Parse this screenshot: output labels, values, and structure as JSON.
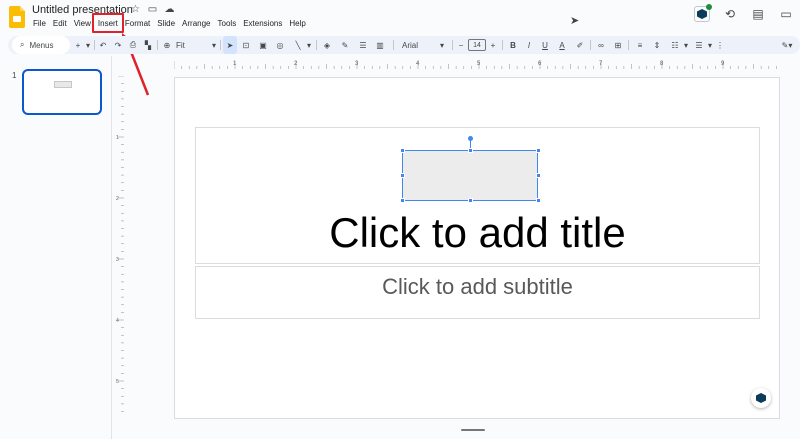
{
  "app": {
    "document_title": "Untitled presentation"
  },
  "menu": {
    "items": [
      "File",
      "Edit",
      "View",
      "Insert",
      "Format",
      "Slide",
      "Arrange",
      "Tools",
      "Extensions",
      "Help"
    ],
    "highlighted": "Insert"
  },
  "toolbar": {
    "menus_label": "Menus",
    "zoom_label": "Fit",
    "font_family": "Arial",
    "font_size": "14",
    "bold": "B",
    "italic": "I",
    "underline": "U",
    "text_color": "A"
  },
  "ruler": {
    "labels": [
      "1",
      "2",
      "3",
      "4",
      "5",
      "6",
      "7",
      "8",
      "9"
    ],
    "vertical_labels": [
      "1",
      "2",
      "3",
      "4",
      "5"
    ]
  },
  "filmstrip": {
    "slide_number": "1"
  },
  "slide": {
    "title_placeholder": "Click to add title",
    "subtitle_placeholder": "Click to add subtitle"
  },
  "colors": {
    "annotation_red": "#e0222a",
    "selection_blue": "#4285f4",
    "accent": "#0b57d0",
    "logo_yellow": "#fbbc04"
  }
}
